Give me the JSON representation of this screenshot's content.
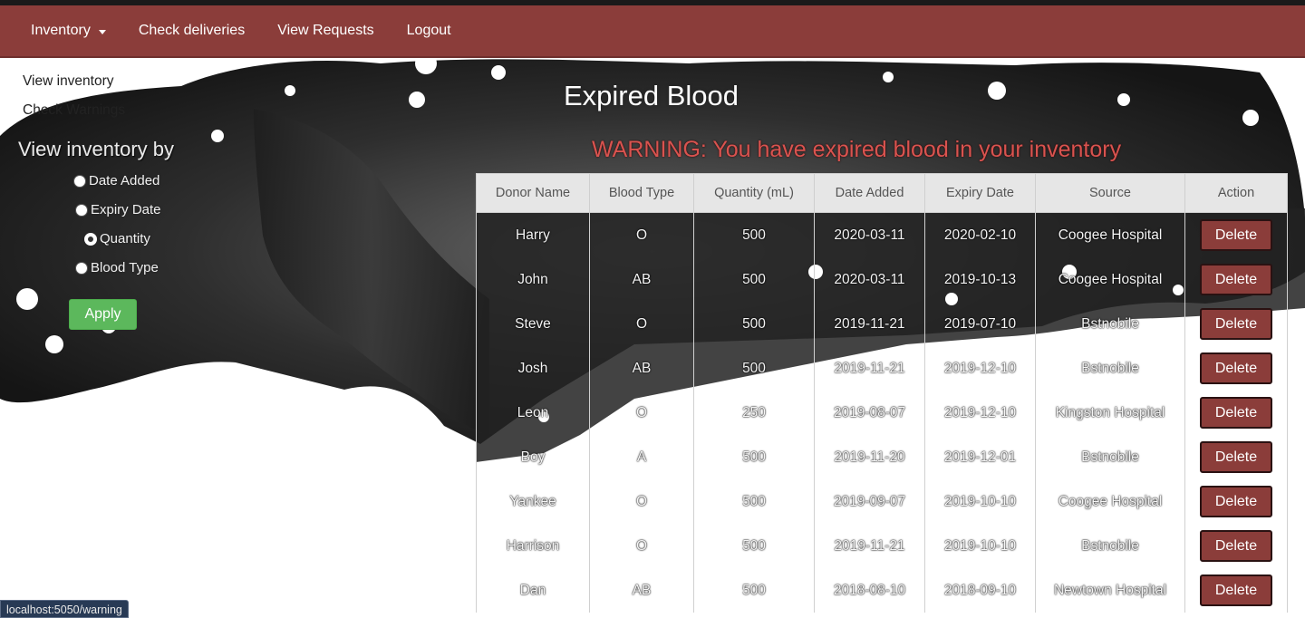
{
  "navbar": {
    "inventory": "Inventory",
    "check_deliveries": "Check deliveries",
    "view_requests": "View Requests",
    "logout": "Logout"
  },
  "sidebar": {
    "view_inventory": "View inventory",
    "check_warnings": "Check Warnings",
    "view_by_heading": "View inventory by",
    "options": [
      {
        "label": "Date Added",
        "selected": false
      },
      {
        "label": "Expiry Date",
        "selected": false
      },
      {
        "label": "Quantity",
        "selected": true
      },
      {
        "label": "Blood Type",
        "selected": false
      }
    ],
    "apply_label": "Apply"
  },
  "main": {
    "title": "Expired Blood",
    "warning": "WARNING: You have expired blood in your inventory"
  },
  "table": {
    "headers": [
      "Donor Name",
      "Blood Type",
      "Quantity (mL)",
      "Date Added",
      "Expiry Date",
      "Source",
      "Action"
    ],
    "delete_label": "Delete",
    "rows": [
      [
        "Harry",
        "O",
        "500",
        "2020-03-11",
        "2020-02-10",
        "Coogee Hospital"
      ],
      [
        "John",
        "AB",
        "500",
        "2020-03-11",
        "2019-10-13",
        "Coogee Hospital"
      ],
      [
        "Steve",
        "O",
        "500",
        "2019-11-21",
        "2019-07-10",
        "Bstnobile"
      ],
      [
        "Josh",
        "AB",
        "500",
        "2019-11-21",
        "2019-12-10",
        "Bstnobile"
      ],
      [
        "Leon",
        "O",
        "250",
        "2019-08-07",
        "2019-12-10",
        "Kingston Hospital"
      ],
      [
        "Boy",
        "A",
        "500",
        "2019-11-20",
        "2019-12-01",
        "Bstnobile"
      ],
      [
        "Yankee",
        "O",
        "500",
        "2019-09-07",
        "2019-10-10",
        "Coogee Hospital"
      ],
      [
        "Harrison",
        "O",
        "500",
        "2019-11-21",
        "2019-10-10",
        "Bstnobile"
      ],
      [
        "Dan",
        "AB",
        "500",
        "2018-08-10",
        "2018-09-10",
        "Newtown Hospital"
      ]
    ]
  },
  "status_bar": {
    "url": "localhost:5050/warning"
  },
  "colors": {
    "navbar": "#8b3d3a",
    "apply_button": "#5cb85c",
    "warning_text": "#d9534f",
    "delete_button": "#8b3d3a"
  }
}
